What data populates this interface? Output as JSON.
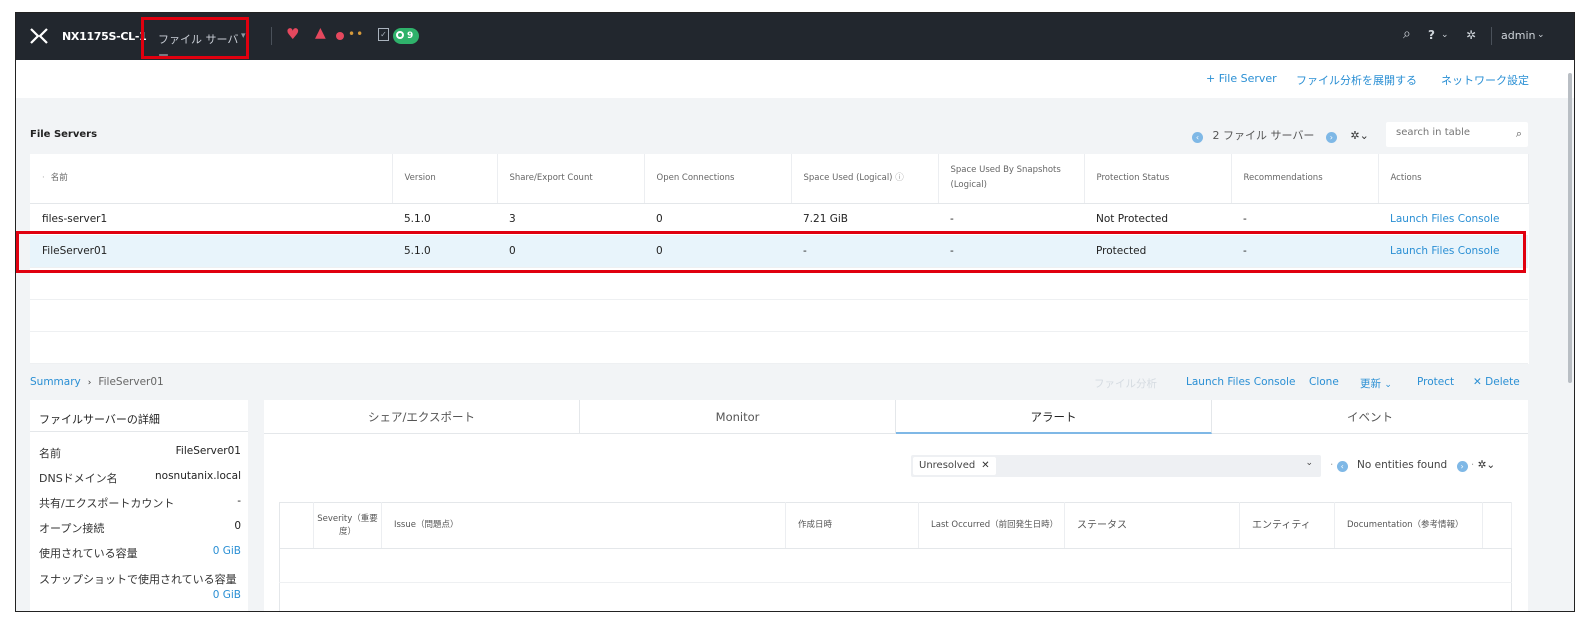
{
  "topbar": {
    "cluster_name": "NX1175S-CL-1",
    "nav_label": "ファイル サーバー",
    "task_count": "9",
    "help_label": "?",
    "user": "admin"
  },
  "actions": {
    "add_file_server": "+ File Server",
    "deploy_analytics": "ファイル分析を展開する",
    "network_settings": "ネットワーク設定"
  },
  "file_servers": {
    "title": "File Servers",
    "pager_text": "2 ファイル サーバー",
    "search_placeholder": "search in table",
    "columns": [
      "名前",
      "Version",
      "Share/Export Count",
      "Open Connections",
      "Space Used (Logical)",
      "Space Used By Snapshots (Logical)",
      "Protection Status",
      "Recommendations",
      "Actions"
    ],
    "rows": [
      {
        "name": "files-server1",
        "version": "5.1.0",
        "share_count": "3",
        "open_connections": "0",
        "space_used": "7.21 GiB",
        "snapshot_space": "-",
        "protection": "Not Protected",
        "recommendations": "-",
        "action": "Launch Files Console"
      },
      {
        "name": "FileServer01",
        "version": "5.1.0",
        "share_count": "0",
        "open_connections": "0",
        "space_used": "-",
        "snapshot_space": "-",
        "protection": "Protected",
        "recommendations": "-",
        "action": "Launch Files Console"
      }
    ]
  },
  "breadcrumb": {
    "root": "Summary",
    "current": "FileServer01"
  },
  "detail_actions": {
    "analytics": "ファイル分析",
    "launch": "Launch Files Console",
    "clone": "Clone",
    "update": "更新",
    "protect": "Protect",
    "delete": "Delete"
  },
  "details": {
    "title": "ファイルサーバーの詳細",
    "items": [
      {
        "label": "名前",
        "value": "FileServer01"
      },
      {
        "label": "DNSドメイン名",
        "value": "nosnutanix.local"
      },
      {
        "label": "共有/エクスポートカウント",
        "value": "-"
      },
      {
        "label": "オープン接続",
        "value": "0"
      },
      {
        "label": "使用されている容量",
        "value": "0 GiB"
      },
      {
        "label": "スナップショットで使用されている容量",
        "value": "0 GiB"
      }
    ]
  },
  "tabs": [
    "シェア/エクスポート",
    "Monitor",
    "アラート",
    "イベント"
  ],
  "alerts": {
    "filter_chip": "Unresolved",
    "no_entities": "No entities found",
    "columns": [
      "Severity（重要度）",
      "Issue（問題点）",
      "作成日時",
      "Last Occurred（前回発生日時）",
      "ステータス",
      "エンティティ",
      "Documentation（参考情報）"
    ]
  },
  "colors": {
    "link": "#2a8fd4",
    "highlight": "#e0000f",
    "topbar": "#22272e",
    "selected_row": "#e8f4fb"
  }
}
